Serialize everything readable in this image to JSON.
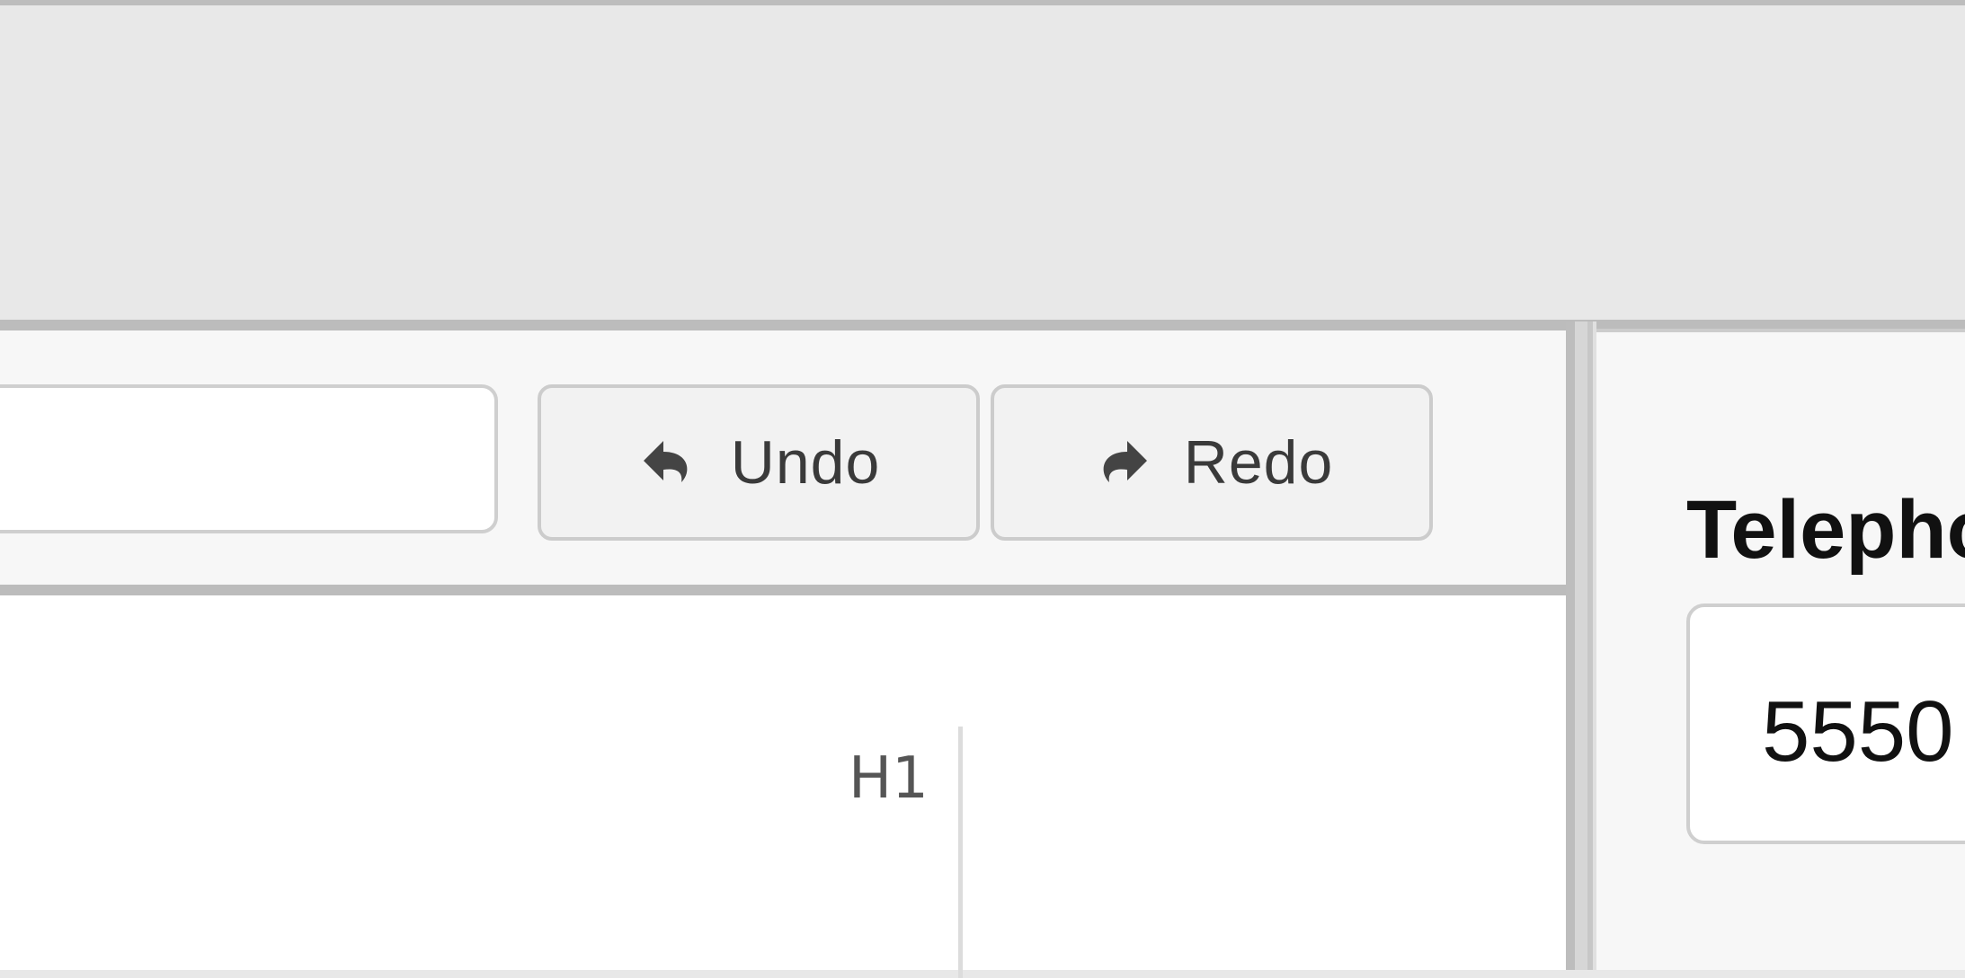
{
  "toolbar": {
    "undo_label": "Undo",
    "redo_label": "Redo",
    "undo_icon": "undo-arrow-icon",
    "redo_icon": "redo-arrow-icon"
  },
  "editor": {
    "heading_badge": "H1"
  },
  "properties": {
    "field_label": "Telepho",
    "field_value": "5550"
  },
  "colors": {
    "background": "#e8e8e8",
    "panel": "#f7f7f7",
    "border": "#cccccc",
    "text": "#3a3a3a"
  }
}
